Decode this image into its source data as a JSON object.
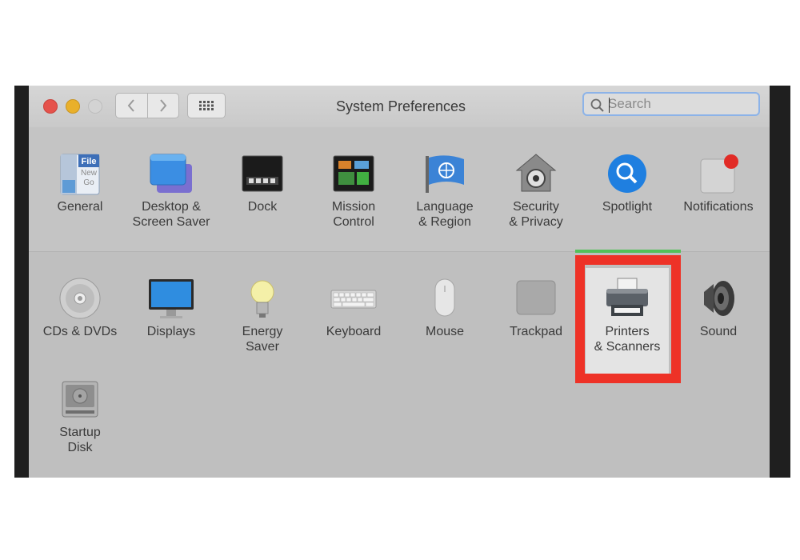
{
  "window": {
    "title": "System Preferences"
  },
  "toolbar": {
    "back_icon": "chevron-left-icon",
    "forward_icon": "chevron-right-icon",
    "grid_icon": "show-all-grid-icon"
  },
  "search": {
    "placeholder": "Search",
    "icon": "magnifier-icon"
  },
  "row1": [
    {
      "label": "General",
      "icon": "general-icon"
    },
    {
      "label": "Desktop & Screen Saver",
      "icon": "desktop-screen-saver-icon"
    },
    {
      "label": "Dock",
      "icon": "dock-icon"
    },
    {
      "label": "Mission Control",
      "icon": "mission-control-icon"
    },
    {
      "label": "Language & Region",
      "icon": "language-region-flag-icon"
    },
    {
      "label": "Security & Privacy",
      "icon": "security-house-icon"
    },
    {
      "label": "Spotlight",
      "icon": "spotlight-magnifier-icon"
    },
    {
      "label": "Notifications",
      "icon": "notifications-icon"
    }
  ],
  "row2": [
    {
      "label": "CDs & DVDs",
      "icon": "cd-dvd-icon"
    },
    {
      "label": "Displays",
      "icon": "displays-monitor-icon"
    },
    {
      "label": "Energy Saver",
      "icon": "energy-saver-bulb-icon"
    },
    {
      "label": "Keyboard",
      "icon": "keyboard-icon"
    },
    {
      "label": "Mouse",
      "icon": "mouse-icon"
    },
    {
      "label": "Trackpad",
      "icon": "trackpad-icon"
    },
    {
      "label": "Printers & Scanners",
      "icon": "printer-icon"
    },
    {
      "label": "Sound",
      "icon": "speaker-icon"
    }
  ],
  "row3": [
    {
      "label": "Startup Disk",
      "icon": "startup-disk-icon"
    }
  ],
  "colors": {
    "highlight": "#ee3227",
    "accent_green": "#53c15a",
    "search_focus": "#8cb3e8"
  }
}
